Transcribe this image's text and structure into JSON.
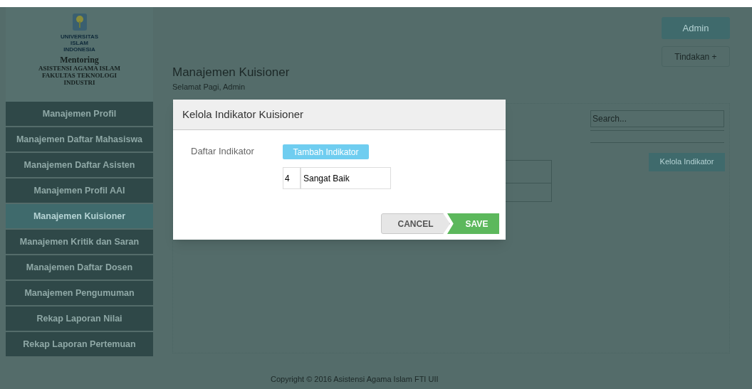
{
  "sidebar": {
    "logo_lines": [
      "UNIVERSITAS",
      "ISLAM",
      "INDONESIA"
    ],
    "app_name": "Mentoring",
    "subtitle": "ASISTENSI AGAMA ISLAM FAKULTAS TEKNOLOGI INDUSTRI",
    "items": [
      {
        "label": "Manajemen Profil",
        "selected": false
      },
      {
        "label": "Manajemen Daftar Mahasiswa",
        "selected": false
      },
      {
        "label": "Manajemen Daftar Asisten",
        "selected": false
      },
      {
        "label": "Manajemen Profil AAI",
        "selected": false
      },
      {
        "label": "Manajemen Kuisioner",
        "selected": true
      },
      {
        "label": "Manajemen Kritik dan Saran",
        "selected": false
      },
      {
        "label": "Manajemen Daftar Dosen",
        "selected": false
      },
      {
        "label": "Manajemen Pengumuman",
        "selected": false
      },
      {
        "label": "Rekap Laporan Nilai",
        "selected": false
      },
      {
        "label": "Rekap Laporan Pertemuan",
        "selected": false
      }
    ]
  },
  "header": {
    "title": "Manajemen Kuisioner",
    "greeting": "Selamat Pagi, Admin",
    "user_button": "Admin",
    "actions_button": "Tindakan +"
  },
  "panel": {
    "search": {
      "placeholder": "Search..."
    },
    "manage_button": "Kelola Indikator"
  },
  "modal": {
    "title": "Kelola Indikator Kuisioner",
    "field_label": "Daftar Indikator",
    "add_button": "Tambah Indikator",
    "indicators": [
      {
        "number": "4",
        "value": "Sangat Baik"
      }
    ],
    "cancel_button": "CANCEL",
    "save_button": "SAVE"
  },
  "footer": "Copyright © 2016 Asistensi Agama Islam FTI UII"
}
